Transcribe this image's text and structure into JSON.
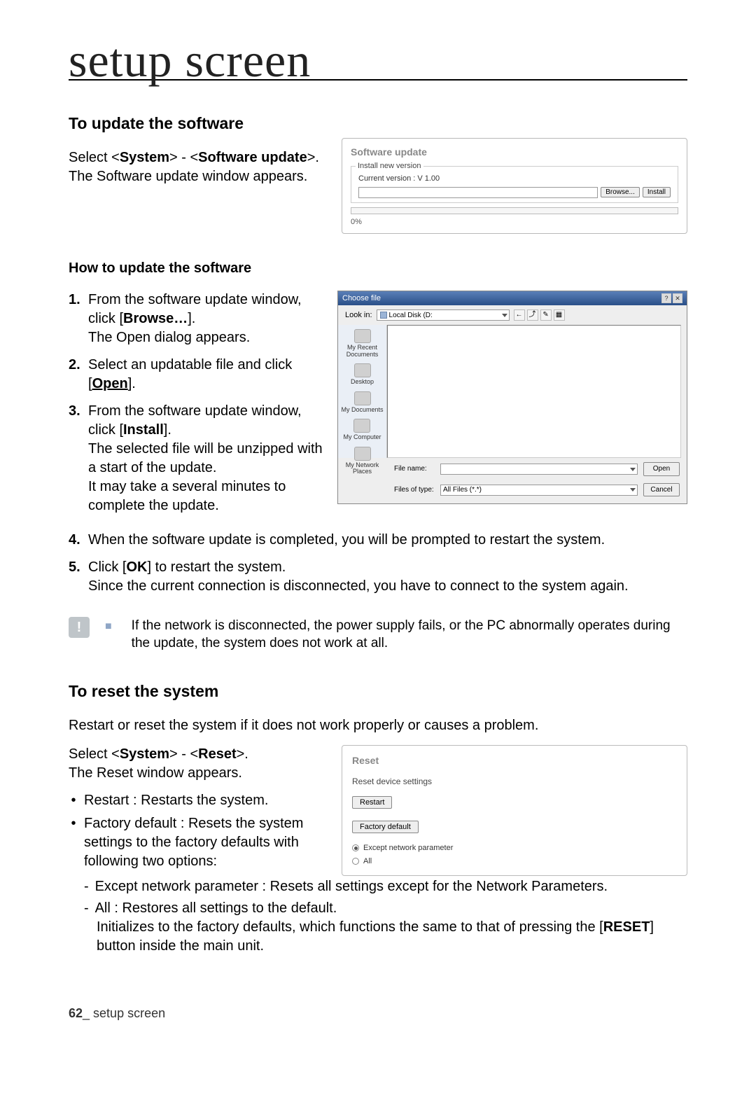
{
  "page": {
    "chapter_title": "setup screen",
    "footer_page": "62",
    "footer_label": "_ setup screen"
  },
  "sec1": {
    "heading": "To update the software",
    "intro1_pre": "Select <",
    "intro1_b1": "System",
    "intro1_mid": "> - <",
    "intro1_b2": "Software update",
    "intro1_post": ">.",
    "intro2": "The Software update window appears."
  },
  "su_panel": {
    "title": "Software update",
    "legend": "Install new version",
    "current": "Current version : V 1.00",
    "browse": "Browse...",
    "install": "Install",
    "pct": "0%"
  },
  "howto": {
    "heading": "How to update the software",
    "s1a": "From the software update window, click [",
    "s1b": "Browse…",
    "s1c": "].",
    "s1d": "The Open dialog appears.",
    "s2a": "Select an updatable file and click [",
    "s2b": "Open",
    "s2c": "].",
    "s3a": "From the software update window, click [",
    "s3b": "Install",
    "s3c": "].",
    "s3d": "The selected file will be unzipped with a start of the update.",
    "s3e": "It may take a several minutes to complete the update.",
    "s4": "When the software update is completed, you will be prompted to restart the system.",
    "s5a": "Click [",
    "s5b": "OK",
    "s5c": "] to restart the system.",
    "s5d": "Since the current connection is disconnected, you have to connect to the system again."
  },
  "cf": {
    "title": "Choose file",
    "lookin_label": "Look in:",
    "lookin_value": "Local Disk (D:",
    "side": [
      "My Recent Documents",
      "Desktop",
      "My Documents",
      "My Computer",
      "My Network Places"
    ],
    "filename_label": "File name:",
    "filetypes_label": "Files of type:",
    "filetypes_value": "All Files (*.*)",
    "open": "Open",
    "cancel": "Cancel"
  },
  "note": {
    "text": "If the network is disconnected, the power supply fails, or the PC abnormally operates during the update, the system does not work at all."
  },
  "sec2": {
    "heading": "To reset the system",
    "intro": "Restart or reset the system if it does not work properly or causes a problem.",
    "sel_pre": "Select <",
    "sel_b1": "System",
    "sel_mid": "> - <",
    "sel_b2": "Reset",
    "sel_post": ">.",
    "sel2": "The Reset window appears.",
    "li1": "Restart : Restarts the system.",
    "li2": "Factory default : Resets the system settings to the factory defaults with following two options:",
    "sub1": "Except network parameter : Resets all settings except for the Network Parameters.",
    "sub2a": "All : Restores all settings to the default.",
    "sub2b_pre": "Initializes to the factory defaults, which functions the same to that of pressing the [",
    "sub2b_b": "RESET",
    "sub2b_post": "] button inside the main unit."
  },
  "rs_panel": {
    "title": "Reset",
    "sub": "Reset device settings",
    "restart": "Restart",
    "factory": "Factory default",
    "r1": "Except network parameter",
    "r2": "All"
  }
}
